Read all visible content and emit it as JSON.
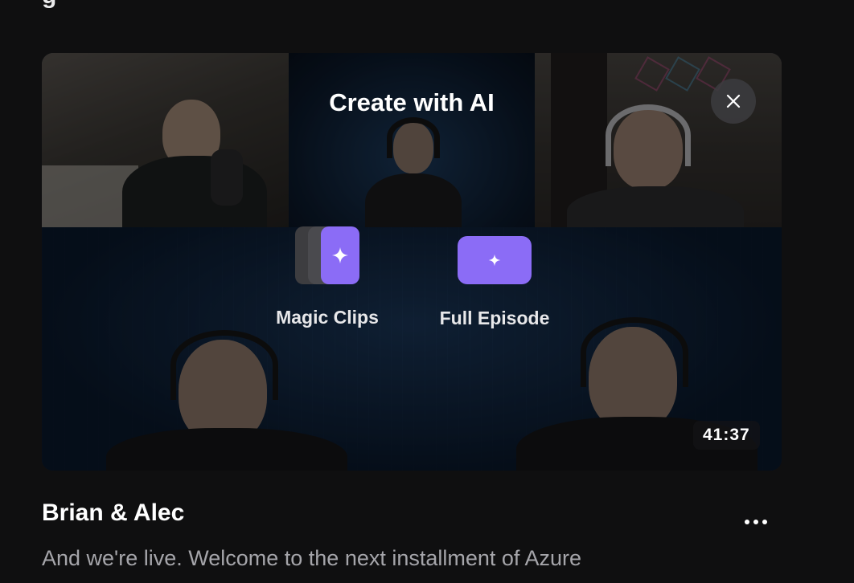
{
  "page": {
    "cut_heading": "g"
  },
  "card": {
    "overlay_title": "Create with AI",
    "options": {
      "magic_clips": {
        "label": "Magic Clips",
        "icon": "sparkle-icon"
      },
      "full_episode": {
        "label": "Full Episode",
        "icon": "sparkle-icon"
      }
    },
    "close_icon": "close-icon",
    "duration": "41:37",
    "accent_color": "#8b6cf6"
  },
  "episode": {
    "title": "Brian & Alec",
    "description": "And we're live. Welcome to the next installment of Azure"
  }
}
